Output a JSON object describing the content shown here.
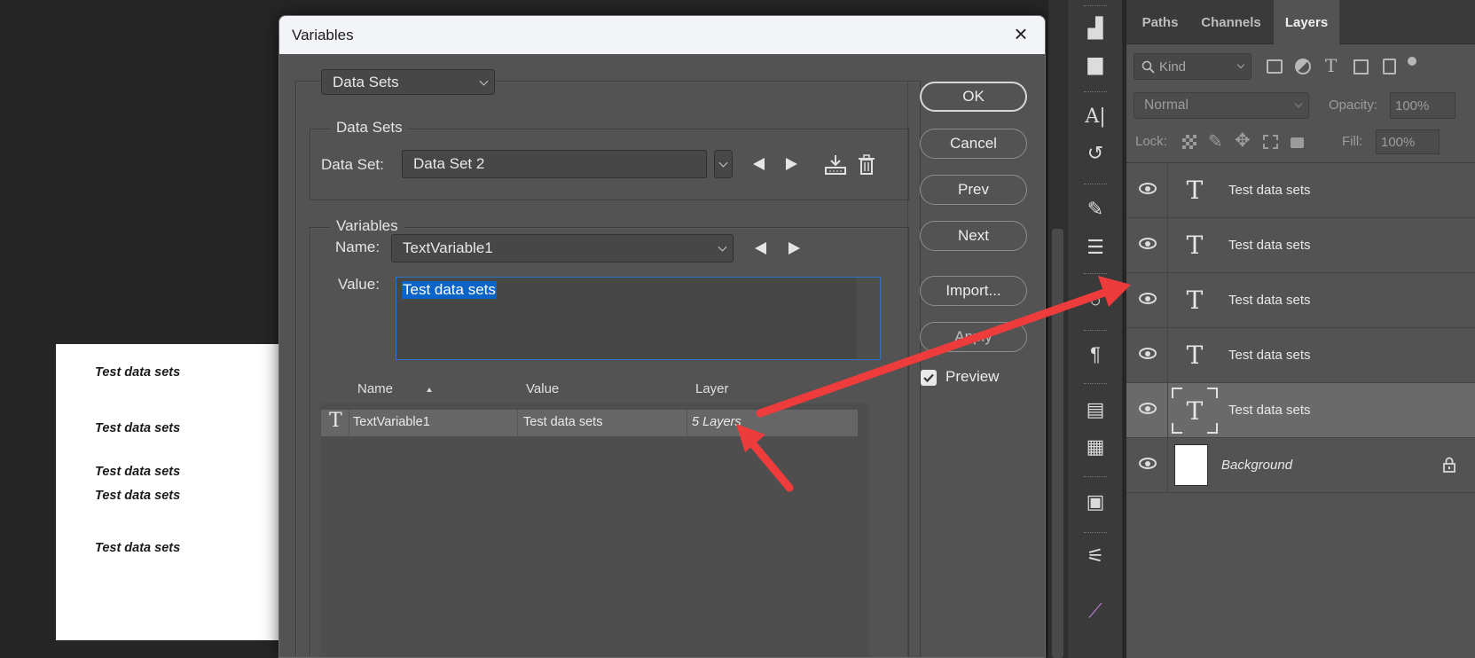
{
  "canvas": {
    "lines": [
      "Test data sets",
      "Test data sets",
      "Test data sets",
      "Test data sets",
      "Test data sets"
    ]
  },
  "dialog": {
    "title": "Variables",
    "close_glyph": "×",
    "mode_dropdown": "Data Sets",
    "data_sets_group": {
      "title": "Data Sets",
      "label": "Data Set:",
      "value": "Data Set 2"
    },
    "variables_group": {
      "title": "Variables",
      "name_label": "Name:",
      "name_value": "TextVariable1",
      "value_label": "Value:",
      "value_text": "Test data sets"
    },
    "table": {
      "columns": [
        "Name",
        "Value",
        "Layer"
      ],
      "rows": [
        {
          "icon": "T",
          "name": "TextVariable1",
          "value": "Test data sets",
          "layer": "5 Layers"
        }
      ]
    },
    "buttons": {
      "ok": "OK",
      "cancel": "Cancel",
      "prev": "Prev",
      "next": "Next",
      "import": "Import...",
      "apply": "Apply"
    },
    "preview": {
      "label": "Preview",
      "checked": true
    }
  },
  "layers_panel": {
    "tabs": [
      "Paths",
      "Channels",
      "Layers"
    ],
    "active_tab": "Layers",
    "filter_placeholder": "Kind",
    "blend_mode": "Normal",
    "opacity_label": "Opacity:",
    "opacity_value": "100%",
    "lock_label": "Lock:",
    "fill_label": "Fill:",
    "fill_value": "100%",
    "layers": [
      {
        "name": "Test data sets",
        "type": "text"
      },
      {
        "name": "Test data sets",
        "type": "text"
      },
      {
        "name": "Test data sets",
        "type": "text"
      },
      {
        "name": "Test data sets",
        "type": "text"
      },
      {
        "name": "Test data sets",
        "type": "text",
        "selected": true
      },
      {
        "name": "Background",
        "type": "background",
        "locked": true
      }
    ]
  },
  "colors": {
    "dialog_bg": "#535353",
    "selection_highlight": "#0a64c8",
    "annotation_arrow": "#ee3b3b"
  }
}
